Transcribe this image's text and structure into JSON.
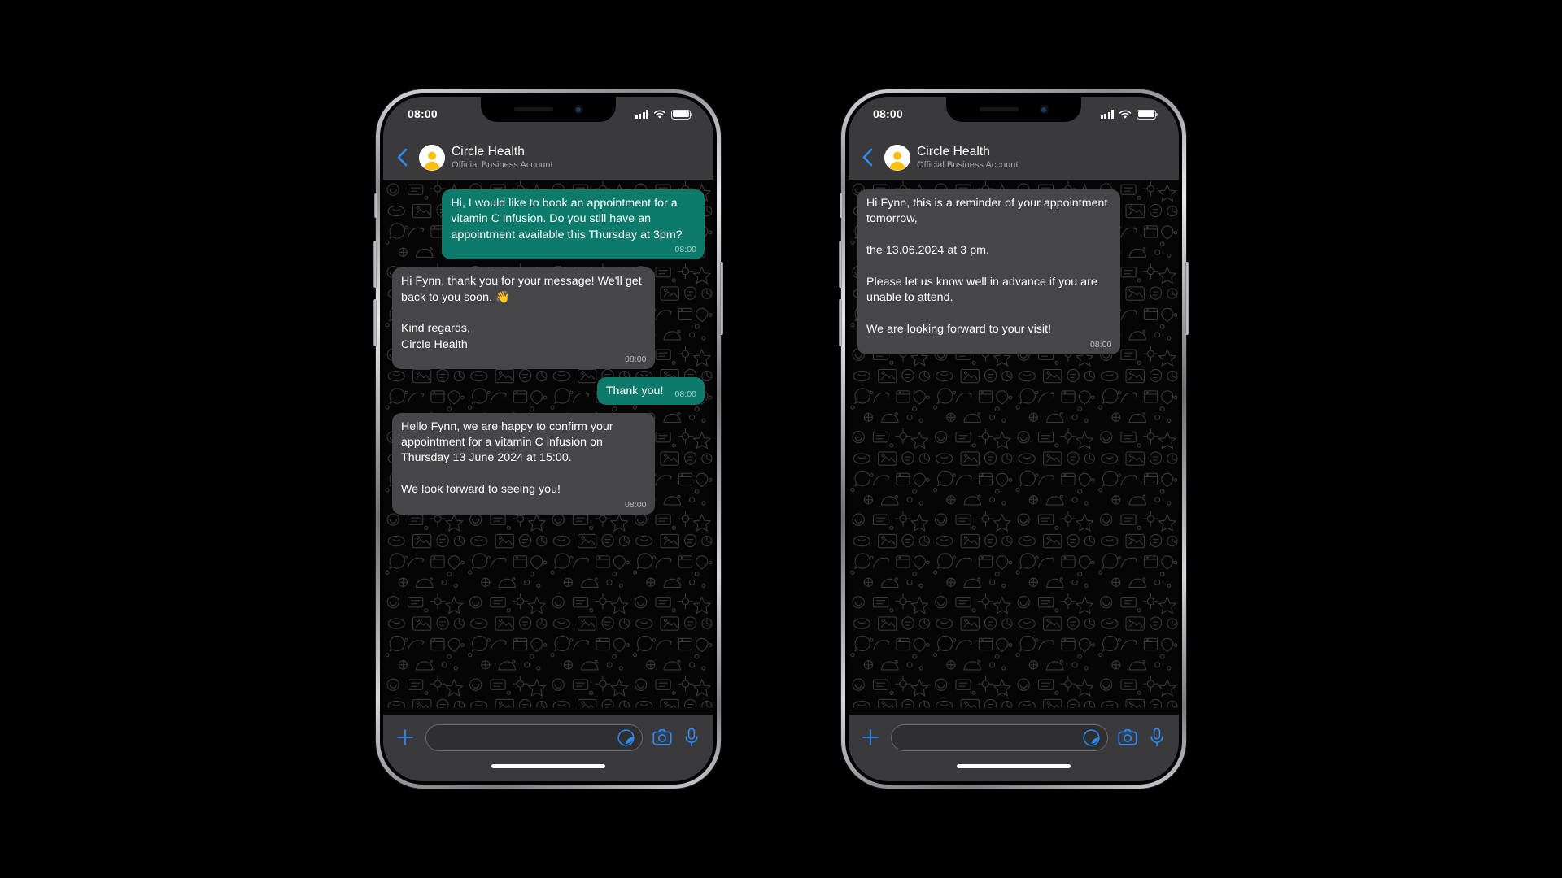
{
  "app": {
    "name": "WhatsApp Business Chat",
    "accent_blue": "#2e8bf5",
    "bubble_out_color": "#0d7b6b",
    "bubble_in_color": "#464649",
    "header_bg": "#3a3a3c",
    "wallpaper_bg": "#050505",
    "avatar_ring_color": "#ffffff",
    "avatar_person_color": "#fbbf14"
  },
  "status_bar": {
    "time": "08:00",
    "signal_icon": "cellular-bars-icon",
    "wifi_icon": "wifi-icon",
    "battery_icon": "battery-full-icon"
  },
  "header": {
    "back_icon": "chevron-left-icon",
    "avatar_icon": "business-avatar-icon",
    "title": "Circle Health",
    "subtitle": "Official Business Account"
  },
  "input_bar": {
    "plus_icon": "plus-icon",
    "placeholder": "",
    "value": "",
    "sticker_icon": "sticker-icon",
    "camera_icon": "camera-icon",
    "mic_icon": "microphone-icon"
  },
  "phones": [
    {
      "id": "phone-left",
      "messages": [
        {
          "direction": "out",
          "text": "Hi, I would like to book an appointment for a vitamin C infusion. Do you still have an appointment available this Thursday at 3pm?",
          "time": "08:00",
          "inline_time": false
        },
        {
          "direction": "in",
          "text": "Hi Fynn, thank you for your message! We'll get back to you soon. 👋\n\nKind regards,\nCircle Health",
          "time": "08:00",
          "inline_time": false
        },
        {
          "direction": "out",
          "text": "Thank you!",
          "time": "08:00",
          "inline_time": true
        },
        {
          "direction": "in",
          "text": "Hello Fynn, we are happy to confirm your appointment for a vitamin C infusion on Thursday 13 June 2024 at 15:00.\n\nWe look forward to seeing you!",
          "time": "08:00",
          "inline_time": false
        }
      ]
    },
    {
      "id": "phone-right",
      "messages": [
        {
          "direction": "in",
          "text": "Hi Fynn, this is a reminder of your appointment tomorrow,\n\nthe 13.06.2024 at 3 pm.\n\nPlease let us know well in advance if you are unable to attend.\n\nWe are looking forward to your visit!",
          "time": "08:00",
          "inline_time": false
        }
      ]
    }
  ]
}
